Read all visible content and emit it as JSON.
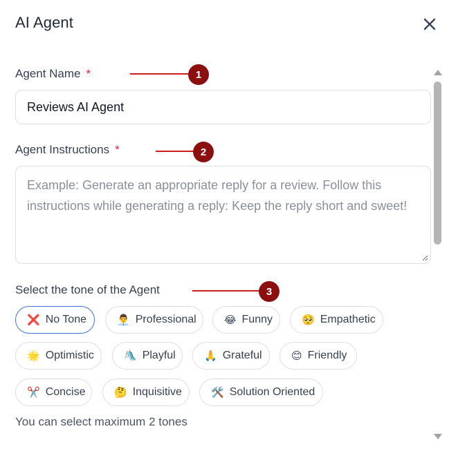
{
  "dialog": {
    "title": "AI Agent",
    "close_icon": "close-icon"
  },
  "fields": {
    "agent_name": {
      "label": "Agent Name",
      "required_mark": "*",
      "value": "Reviews AI Agent"
    },
    "agent_instructions": {
      "label": "Agent Instructions",
      "required_mark": "*",
      "placeholder": "Example: Generate an appropriate reply for a review. Follow this instructions while generating a reply: Keep the reply short and sweet!"
    }
  },
  "tone": {
    "label": "Select the tone of the Agent",
    "hint": "You can select maximum 2 tones",
    "options": [
      {
        "emoji": "❌",
        "label": "No Tone",
        "selected": true
      },
      {
        "emoji": "👨‍💼",
        "label": "Professional",
        "selected": false
      },
      {
        "emoji": "😂",
        "label": "Funny",
        "selected": false
      },
      {
        "emoji": "🥺",
        "label": "Empathetic",
        "selected": false
      },
      {
        "emoji": "🌟",
        "label": "Optimistic",
        "selected": false
      },
      {
        "emoji": "🛝",
        "label": "Playful",
        "selected": false
      },
      {
        "emoji": "🙏",
        "label": "Grateful",
        "selected": false
      },
      {
        "emoji": "😊",
        "label": "Friendly",
        "selected": false
      },
      {
        "emoji": "✂️",
        "label": "Concise",
        "selected": false
      },
      {
        "emoji": "🤔",
        "label": "Inquisitive",
        "selected": false
      },
      {
        "emoji": "🛠️",
        "label": "Solution Oriented",
        "selected": false
      }
    ]
  },
  "callouts": [
    "1",
    "2",
    "3"
  ],
  "colors": {
    "accent_selected": "#3b6fd8",
    "required": "#e11d48",
    "callout_line": "#cc1b1b",
    "callout_badge": "#8b0f0f"
  }
}
